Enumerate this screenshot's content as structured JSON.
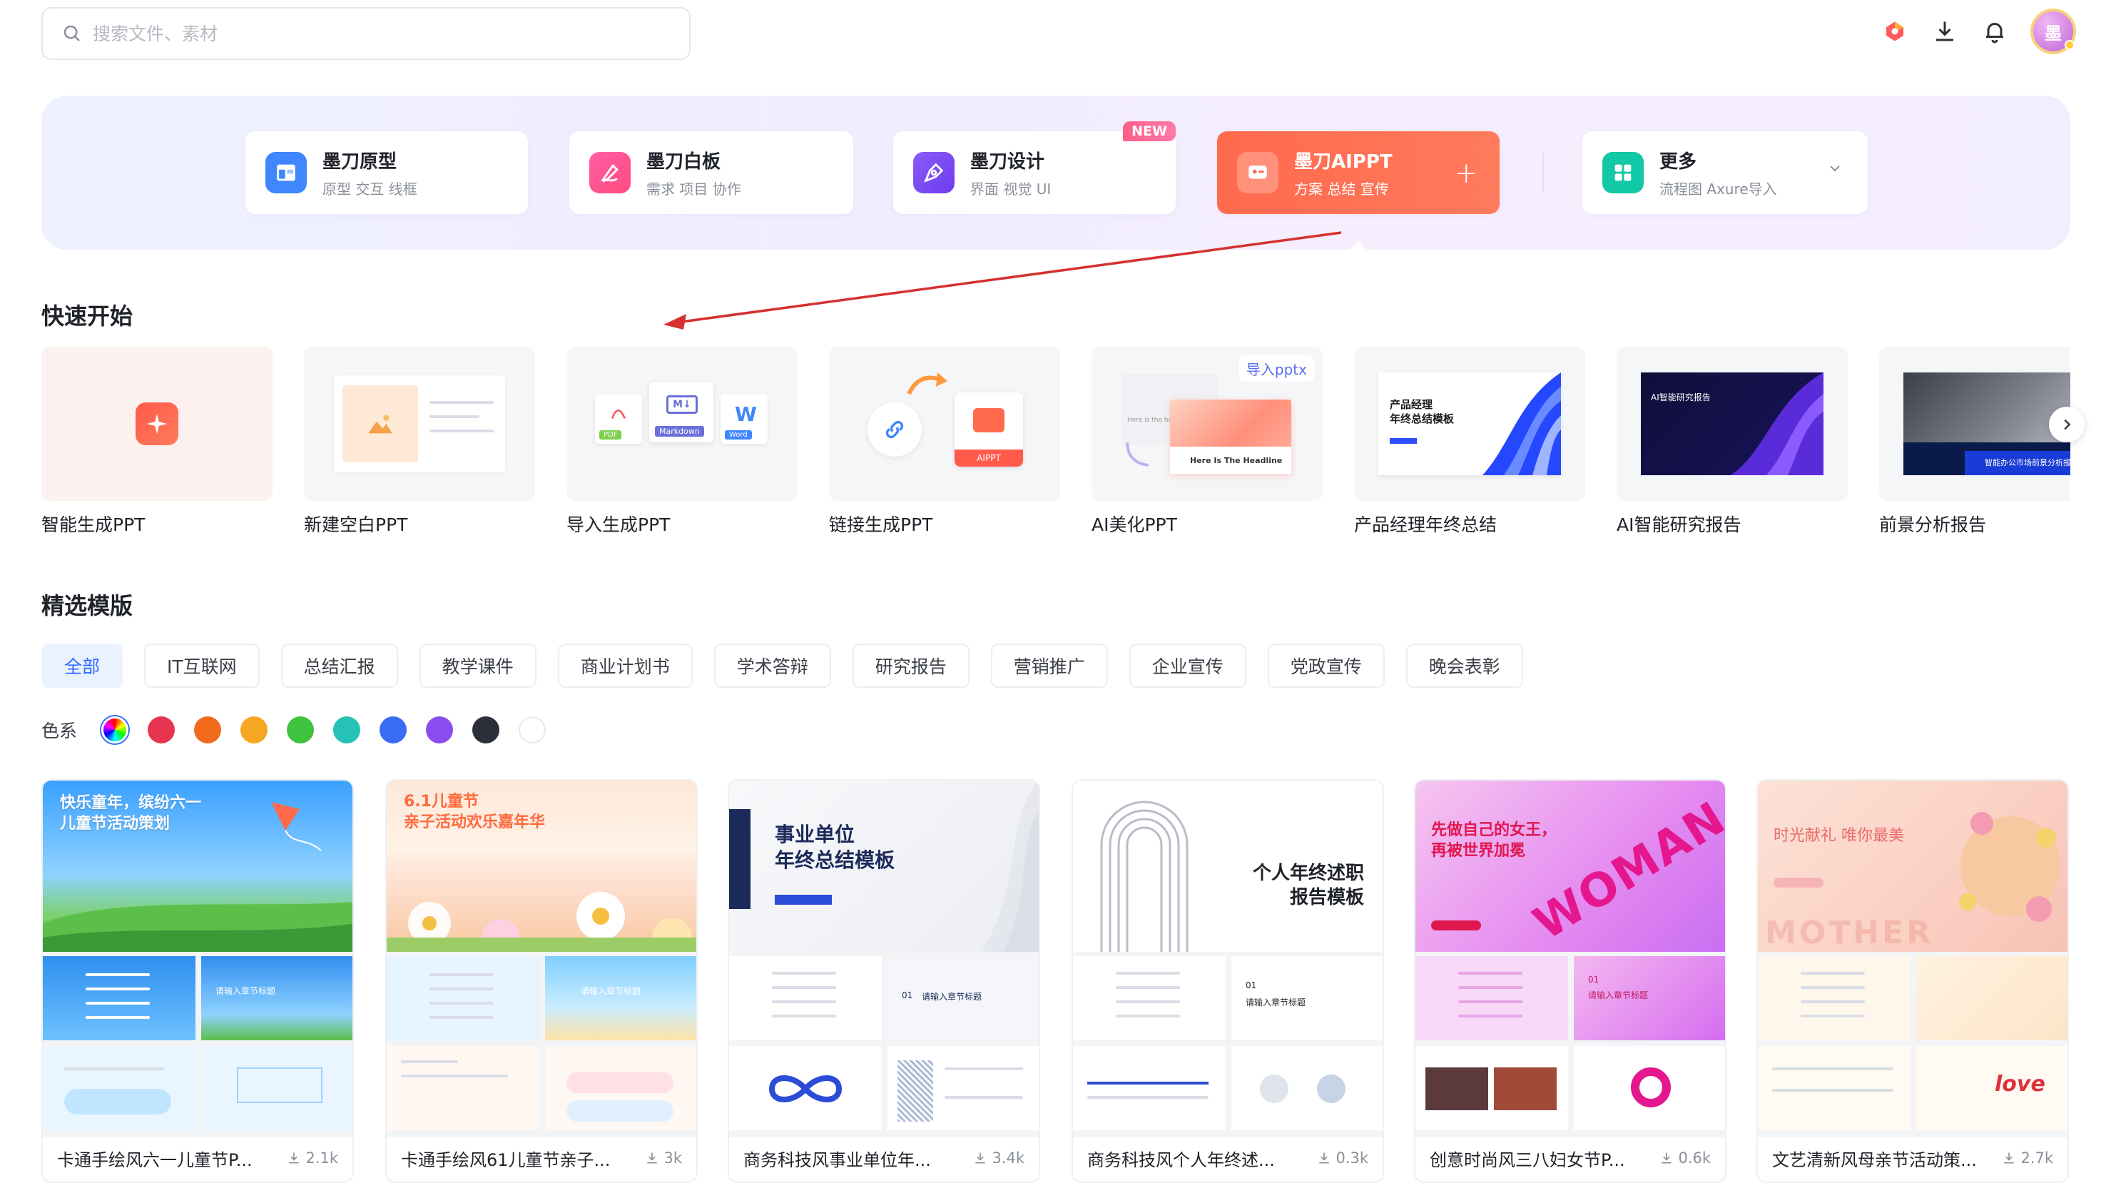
{
  "search": {
    "placeholder": "搜索文件、素材"
  },
  "products": [
    {
      "title": "墨刀原型",
      "subtitle": "原型 交互 线框"
    },
    {
      "title": "墨刀白板",
      "subtitle": "需求 项目 协作"
    },
    {
      "title": "墨刀设计",
      "subtitle": "界面 视觉 UI",
      "badge": "NEW"
    },
    {
      "title": "墨刀AIPPT",
      "subtitle": "方案 总结 宣传"
    },
    {
      "title": "更多",
      "subtitle": "流程图 Axure导入"
    }
  ],
  "user": {
    "avatar_text": "墨"
  },
  "quick_start": {
    "title": "快速开始",
    "items": [
      {
        "label": "智能生成PPT"
      },
      {
        "label": "新建空白PPT"
      },
      {
        "label": "导入生成PPT",
        "tags": [
          "PDF",
          "Markdown",
          "Word"
        ]
      },
      {
        "label": "链接生成PPT",
        "tag": "AIPPT"
      },
      {
        "label": "AI美化PPT",
        "tag": "导入pptx",
        "headline": "Here Is The Headline",
        "hint": "Here is the he"
      },
      {
        "label": "产品经理年终总结",
        "thumb_title": "产品经理\n年终总结模板"
      },
      {
        "label": "AI智能研究报告",
        "thumb_title": "AI智能研究报告"
      },
      {
        "label": "前景分析报告",
        "thumb_title": "智能办公市场前景分析报告"
      }
    ]
  },
  "templates": {
    "title": "精选模版",
    "tabs": [
      "全部",
      "IT互联网",
      "总结汇报",
      "教学课件",
      "商业计划书",
      "学术答辩",
      "研究报告",
      "营销推广",
      "企业宣传",
      "党政宣传",
      "晚会表彰"
    ],
    "active_tab": "全部",
    "color_label": "色系",
    "colors": [
      "#e8344e",
      "#f26b1d",
      "#f5a623",
      "#3ec23f",
      "#25c2b5",
      "#3a6cf4",
      "#8b4cf0",
      "#2b2f3a",
      "#ffffff"
    ],
    "cards": [
      {
        "name": "卡通手绘风六一儿童节P...",
        "downloads": "2.1k",
        "cover_title": "快乐童年，缤纷六一\n儿童节活动策划",
        "slide_label": "请输入章节标题"
      },
      {
        "name": "卡通手绘风61儿童节亲子...",
        "downloads": "3k",
        "cover_title": "6.1儿童节\n亲子活动欢乐嘉年华",
        "slide_label": "请输入章节标题"
      },
      {
        "name": "商务科技风事业单位年...",
        "downloads": "3.4k",
        "cover_title": "事业单位\n年终总结模板",
        "slide_label": "请输入章节标题",
        "slide_number": "01"
      },
      {
        "name": "商务科技风个人年终述...",
        "downloads": "0.3k",
        "cover_title": "个人年终述职\n报告模板",
        "slide_label": "请输入章节标题",
        "slide_number": "01"
      },
      {
        "name": "创意时尚风三八妇女节P...",
        "downloads": "0.6k",
        "cover_title": "先做自己的女王，\n再被世界加冕",
        "cover_art": "WOMAN",
        "slide_label": "请输入章节标题",
        "slide_number": "01"
      },
      {
        "name": "文艺清新风母亲节活动策...",
        "downloads": "2.7k",
        "cover_title": "时光献礼 唯你最美",
        "cover_art": "MOTHER",
        "sub_art": "love"
      }
    ]
  },
  "accent_color": "#2f6bff",
  "ai_color": "#ff6a4d"
}
